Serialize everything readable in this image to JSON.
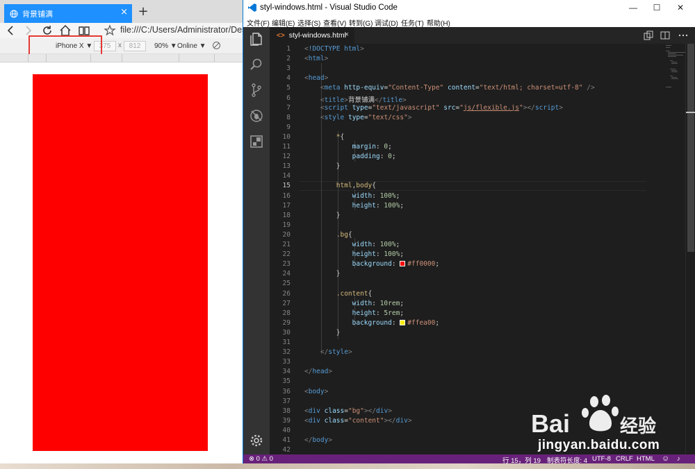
{
  "browser": {
    "tab_title": "背景铺满",
    "tab_close": "×",
    "new_tab": "+",
    "address": "file:///C:/Users/Administrator/Deskt",
    "device": "iPhone X ▼",
    "width": "375",
    "height": "812",
    "times": "x",
    "zoom": "90% ▼",
    "network": "Online ▼",
    "page_bg_color": "#ff0000"
  },
  "vscode": {
    "window_title": "styl-windows.html - Visual Studio Code",
    "controls": {
      "minimize": "—",
      "maximize": "☐",
      "close": "✕"
    },
    "menus": [
      "文件(F)",
      "编辑(E)",
      "选择(S)",
      "查看(V)",
      "转到(G)",
      "调试(D)",
      "任务(T)",
      "帮助(H)"
    ],
    "editor_tab": {
      "icon": "<>",
      "label": "styl-windows.html",
      "close": "×"
    },
    "current_line": 15,
    "lines": [
      {
        "n": "1",
        "html": "<span class='g'>&lt;</span><span class='k'>!DOCTYPE html</span><span class='g'>&gt;</span>"
      },
      {
        "n": "2",
        "html": "<span class='g'>&lt;</span><span class='k'>html</span><span class='g'>&gt;</span>"
      },
      {
        "n": "3",
        "html": ""
      },
      {
        "n": "4",
        "html": "<span class='g'>&lt;</span><span class='k'>head</span><span class='g'>&gt;</span>"
      },
      {
        "n": "5",
        "html": "    <span class='g'>&lt;</span><span class='k'>meta</span> <span class='a'>http-equiv</span>=<span class='s'>\"Content-Type\"</span> <span class='a'>content</span>=<span class='s'>\"text/html; charset=utf-8\"</span> <span class='g'>/&gt;</span>"
      },
      {
        "n": "6",
        "html": "    <span class='g'>&lt;</span><span class='k'>title</span><span class='g'>&gt;</span>背景铺满<span class='g'>&lt;/</span><span class='k'>title</span><span class='g'>&gt;</span>"
      },
      {
        "n": "7",
        "html": "    <span class='g'>&lt;</span><span class='k'>script</span> <span class='a'>type</span>=<span class='s'>\"text/javascript\"</span> <span class='a'>src</span>=<span class='s'>\"<u>js/flexible.js</u>\"</span><span class='g'>&gt;&lt;/</span><span class='k'>script</span><span class='g'>&gt;</span>"
      },
      {
        "n": "8",
        "html": "    <span class='g'>&lt;</span><span class='k'>style</span> <span class='a'>type</span>=<span class='s'>\"text/css\"</span><span class='g'>&gt;</span>"
      },
      {
        "n": "9",
        "html": ""
      },
      {
        "n": "10",
        "html": "        <span class='sel'>*</span>{"
      },
      {
        "n": "11",
        "html": "            <span class='p'>margin</span>: <span class='v'>0</span>;"
      },
      {
        "n": "12",
        "html": "            <span class='p'>padding</span>: <span class='v'>0</span>;"
      },
      {
        "n": "13",
        "html": "        }"
      },
      {
        "n": "14",
        "html": ""
      },
      {
        "n": "15",
        "html": "        <span class='sel'>html</span>,<span class='sel'>body</span>{"
      },
      {
        "n": "16",
        "html": "            <span class='p'>width</span>: <span class='v'>100%</span>;"
      },
      {
        "n": "17",
        "html": "            <span class='p'>height</span>: <span class='v'>100%</span>;"
      },
      {
        "n": "18",
        "html": "        }"
      },
      {
        "n": "19",
        "html": ""
      },
      {
        "n": "20",
        "html": "        <span class='sel'>.bg</span>{"
      },
      {
        "n": "21",
        "html": "            <span class='p'>width</span>: <span class='v'>100%</span>;"
      },
      {
        "n": "22",
        "html": "            <span class='p'>height</span>: <span class='v'>100%</span>;"
      },
      {
        "n": "23",
        "html": "            <span class='p'>background</span>: <span class='swatch' style='background:#ff0000'></span><span class='s'>#ff0000</span>;"
      },
      {
        "n": "24",
        "html": "        }"
      },
      {
        "n": "25",
        "html": ""
      },
      {
        "n": "26",
        "html": "        <span class='sel'>.content</span>{"
      },
      {
        "n": "27",
        "html": "            <span class='p'>width</span>: <span class='v'>10rem</span>;"
      },
      {
        "n": "28",
        "html": "            <span class='p'>height</span>: <span class='v'>5rem</span>;"
      },
      {
        "n": "29",
        "html": "            <span class='p'>background</span>: <span class='swatch' style='background:#ffea00'></span><span class='s'>#ffea00</span>;"
      },
      {
        "n": "30",
        "html": "        }"
      },
      {
        "n": "31",
        "html": ""
      },
      {
        "n": "32",
        "html": "    <span class='g'>&lt;/</span><span class='k'>style</span><span class='g'>&gt;</span>"
      },
      {
        "n": "33",
        "html": ""
      },
      {
        "n": "34",
        "html": "<span class='g'>&lt;/</span><span class='k'>head</span><span class='g'>&gt;</span>"
      },
      {
        "n": "35",
        "html": ""
      },
      {
        "n": "36",
        "html": "<span class='g'>&lt;</span><span class='k'>body</span><span class='g'>&gt;</span>"
      },
      {
        "n": "37",
        "html": ""
      },
      {
        "n": "38",
        "html": "<span class='g'>&lt;</span><span class='k'>div</span> <span class='a'>class</span>=<span class='s'>\"bg\"</span><span class='g'>&gt;&lt;/</span><span class='k'>div</span><span class='g'>&gt;</span>"
      },
      {
        "n": "39",
        "html": "<span class='g'>&lt;</span><span class='k'>div</span> <span class='a'>class</span>=<span class='s'>\"content\"</span><span class='g'>&gt;&lt;/</span><span class='k'>div</span><span class='g'>&gt;</span>"
      },
      {
        "n": "40",
        "html": ""
      },
      {
        "n": "41",
        "html": "<span class='g'>&lt;/</span><span class='k'>body</span><span class='g'>&gt;</span>"
      },
      {
        "n": "42",
        "html": ""
      }
    ],
    "status": {
      "problems": "⊗ 0 ⚠ 0",
      "position": "行 15，列 19",
      "tab_size": "制表符长度: 4",
      "encoding": "UTF-8",
      "eol": "CRLF",
      "language": "HTML",
      "smiley": "☺",
      "bell": "♪"
    },
    "colors": {
      "status_bar": "#68217a",
      "editor_bg": "#1e1e1e",
      "activity_bar": "#333333"
    }
  },
  "watermark": {
    "logo": "Bai 经验",
    "url": "jingyan.baidu.com"
  }
}
